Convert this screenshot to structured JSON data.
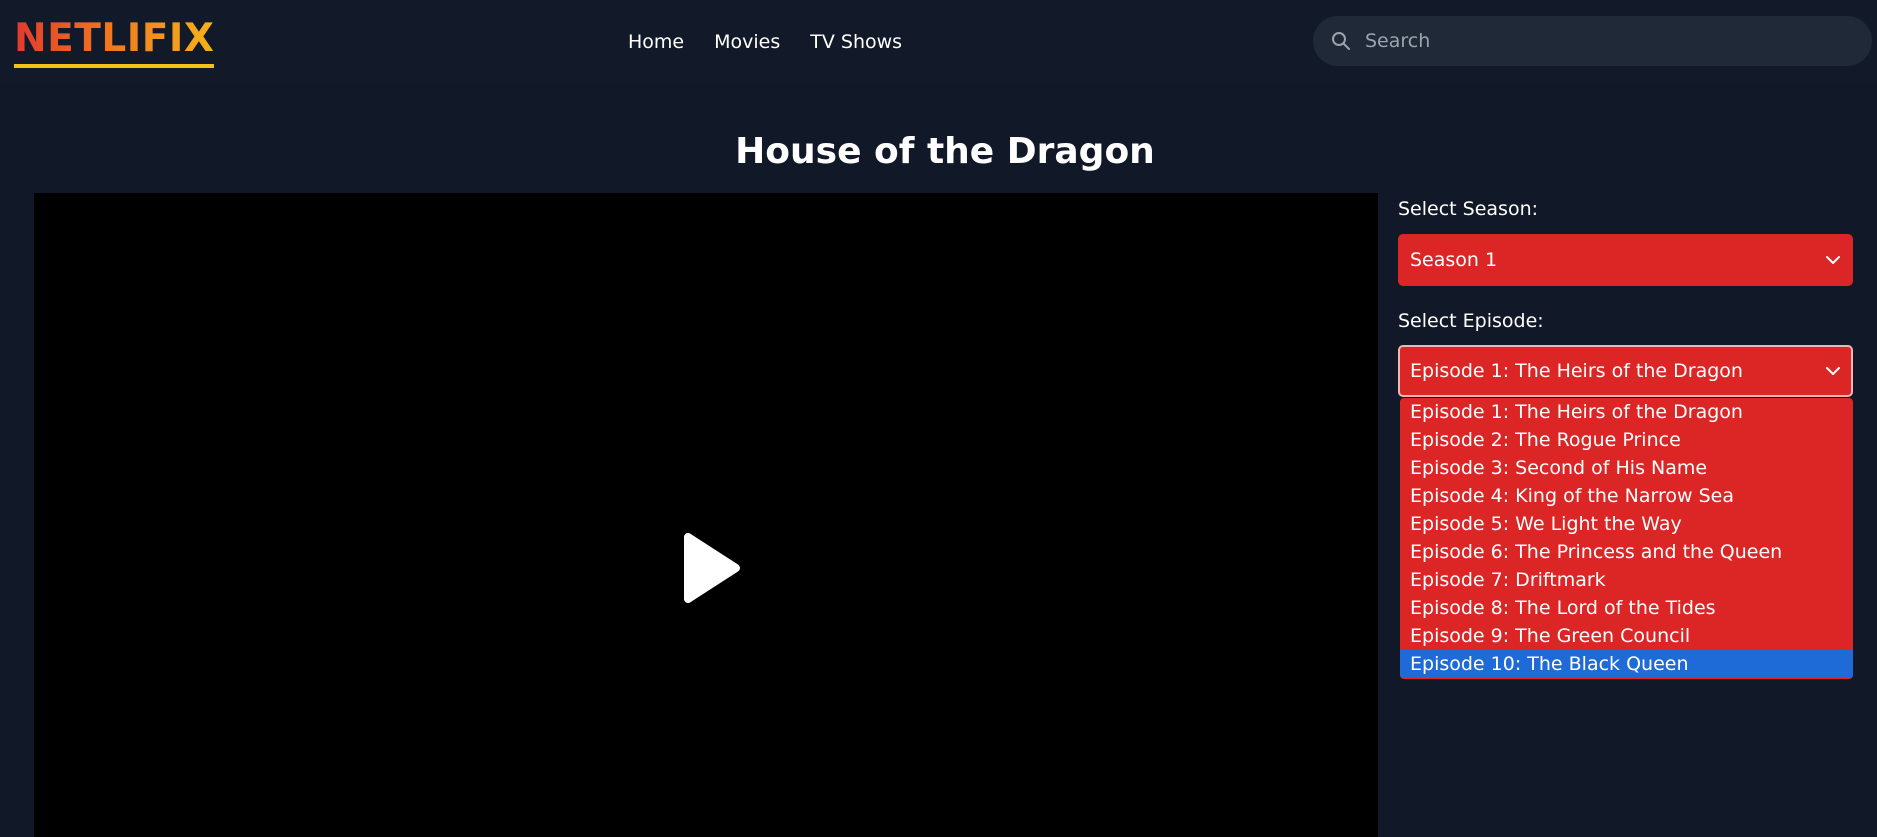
{
  "brand": {
    "logo_text": "NETLIFIX",
    "gradient": [
      "#e23a2e",
      "#f07a1f",
      "#f6b21a"
    ],
    "underline_color": "#f2c21b"
  },
  "nav": {
    "items": [
      {
        "label": "Home"
      },
      {
        "label": "Movies"
      },
      {
        "label": "TV Shows"
      }
    ]
  },
  "search": {
    "placeholder": "Search",
    "value": "",
    "icon": "search-icon"
  },
  "page": {
    "title": "House of the Dragon"
  },
  "player": {
    "icon": "play-icon",
    "background": "#000000"
  },
  "season_select": {
    "label": "Select Season:",
    "value": "Season 1",
    "icon": "chevron-down-icon"
  },
  "episode_select": {
    "label": "Select Episode:",
    "value": "Episode 1: The Heirs of the Dragon",
    "icon": "chevron-down-icon",
    "options": [
      "Episode 1: The Heirs of the Dragon",
      "Episode 2: The Rogue Prince",
      "Episode 3: Second of His Name",
      "Episode 4: King of the Narrow Sea",
      "Episode 5: We Light the Way",
      "Episode 6: The Princess and the Queen",
      "Episode 7: Driftmark",
      "Episode 8: The Lord of the Tides",
      "Episode 9: The Green Council",
      "Episode 10: The Black Queen"
    ],
    "highlighted_option": "Episode 10: The Black Queen"
  },
  "colors": {
    "page_background": "#111827",
    "header_background": "#121a29",
    "accent_red": "#dc2626",
    "highlight_blue": "#1e6ad6",
    "search_background": "#1f2937"
  }
}
